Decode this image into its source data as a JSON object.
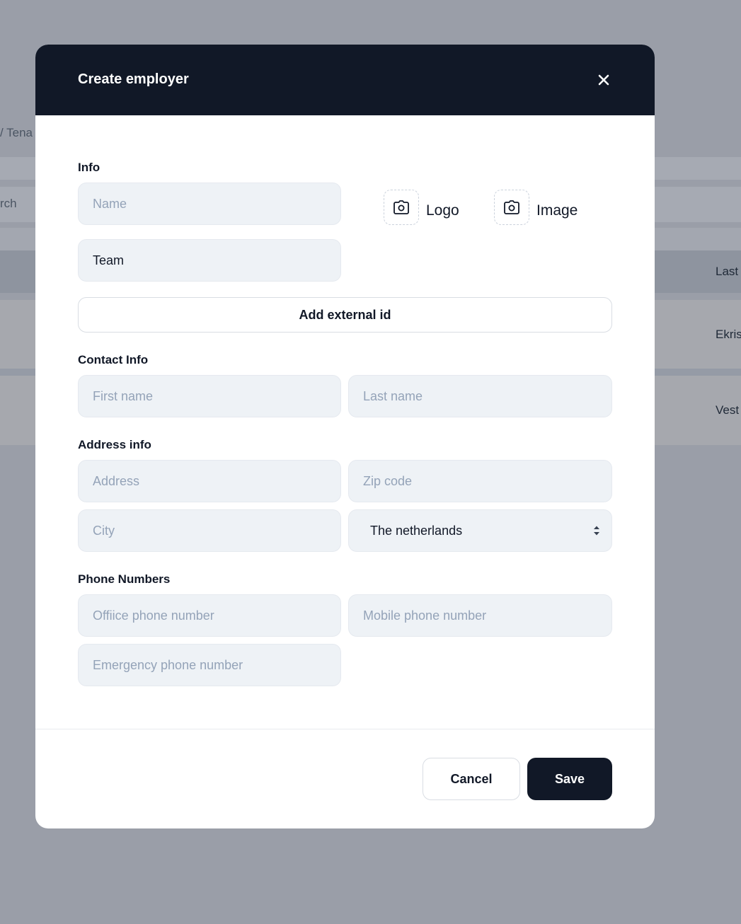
{
  "background": {
    "breadcrumb": "/ Tena",
    "search_fragment": "rch",
    "column_header": "Last",
    "row_values": [
      "Ekris",
      "Vest"
    ]
  },
  "modal": {
    "title": "Create employer",
    "close_icon": "close-icon",
    "info": {
      "label": "Info",
      "name_placeholder": "Name",
      "team_value": "Team",
      "logo_label": "Logo",
      "image_label": "Image",
      "upload_icon": "camera-icon",
      "add_external_id_label": "Add external id"
    },
    "contact": {
      "label": "Contact Info",
      "first_name_placeholder": "First name",
      "last_name_placeholder": "Last name"
    },
    "address": {
      "label": "Address info",
      "address_placeholder": "Address",
      "zip_placeholder": "Zip code",
      "city_placeholder": "City",
      "country_value": "The netherlands"
    },
    "phones": {
      "label": "Phone Numbers",
      "office_placeholder": "Offiice phone number",
      "mobile_placeholder": "Mobile phone number",
      "emergency_placeholder": "Emergency phone number"
    },
    "footer": {
      "cancel_label": "Cancel",
      "save_label": "Save"
    }
  },
  "colors": {
    "header_bg": "#111827",
    "field_bg": "#eef2f6",
    "overlay": "#9a9ea8"
  }
}
